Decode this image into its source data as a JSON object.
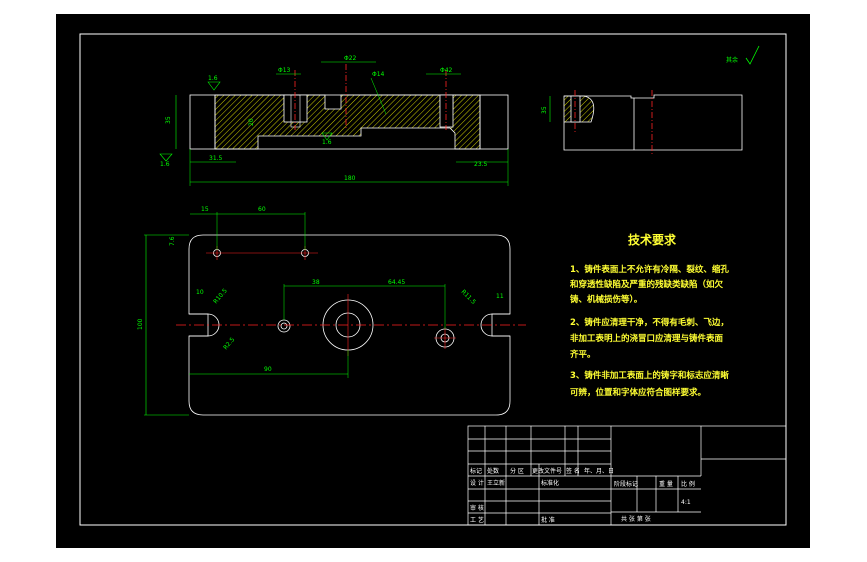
{
  "drawing": {
    "roughness_symbol": "其余",
    "front_view": {
      "dim_phi13": "Φ13",
      "dim_phi22": "Φ22",
      "dim_phi14": "Φ14",
      "dim_phi42": "Φ42",
      "dim_16_left": "1.6",
      "dim_16_mid": "1.6",
      "dim_16_right": "1.6",
      "dim_height": "35",
      "dim_inner": "20",
      "dim_left_offset": "31.5",
      "dim_right_offset": "23.5",
      "dim_total": "180"
    },
    "side_view": {
      "dim_height": "35"
    },
    "top_view": {
      "dim_15": "15",
      "dim_60": "60",
      "dim_76": "7.6",
      "dim_38": "38",
      "dim_6445": "64.45",
      "dim_10": "10",
      "dim_11": "11",
      "dim_r105": "R10.5",
      "dim_r115": "R11.5",
      "dim_r23": "R2.5",
      "dim_100": "100",
      "dim_90": "90"
    },
    "tech_requirements": {
      "title": "技术要求",
      "line1": "1、铸件表面上不允许有冷隔、裂纹、缩孔",
      "line2": "和穿透性缺陷及严重的残缺类缺陷（如欠",
      "line3": "铸、机械损伤等）。",
      "line4": "2、铸件应清理干净，不得有毛刺、飞边，",
      "line5": "非加工表明上的浇冒口应清理与铸件表面",
      "line6": "齐平。",
      "line7": "3、铸件非加工表面上的铸字和标志应清晰",
      "line8": "可辨，位置和字体应符合图样要求。"
    },
    "title_block": {
      "h_mark": "标记",
      "h_count": "处数",
      "h_zone": "分 区",
      "h_docno": "更改文件号",
      "h_sign": "签 名",
      "h_date": "年、月、日",
      "designer_label": "设 计",
      "designer_name": "王立新",
      "std_label": "标准化",
      "stage_label": "阶段标记",
      "weight_label": "重 量",
      "scale_label": "比 例",
      "scale_value": "4:1",
      "review_label": "审 核",
      "process_label": "工 艺",
      "approve_label": "批 准",
      "sheet_text": "共    张    第    张"
    }
  }
}
